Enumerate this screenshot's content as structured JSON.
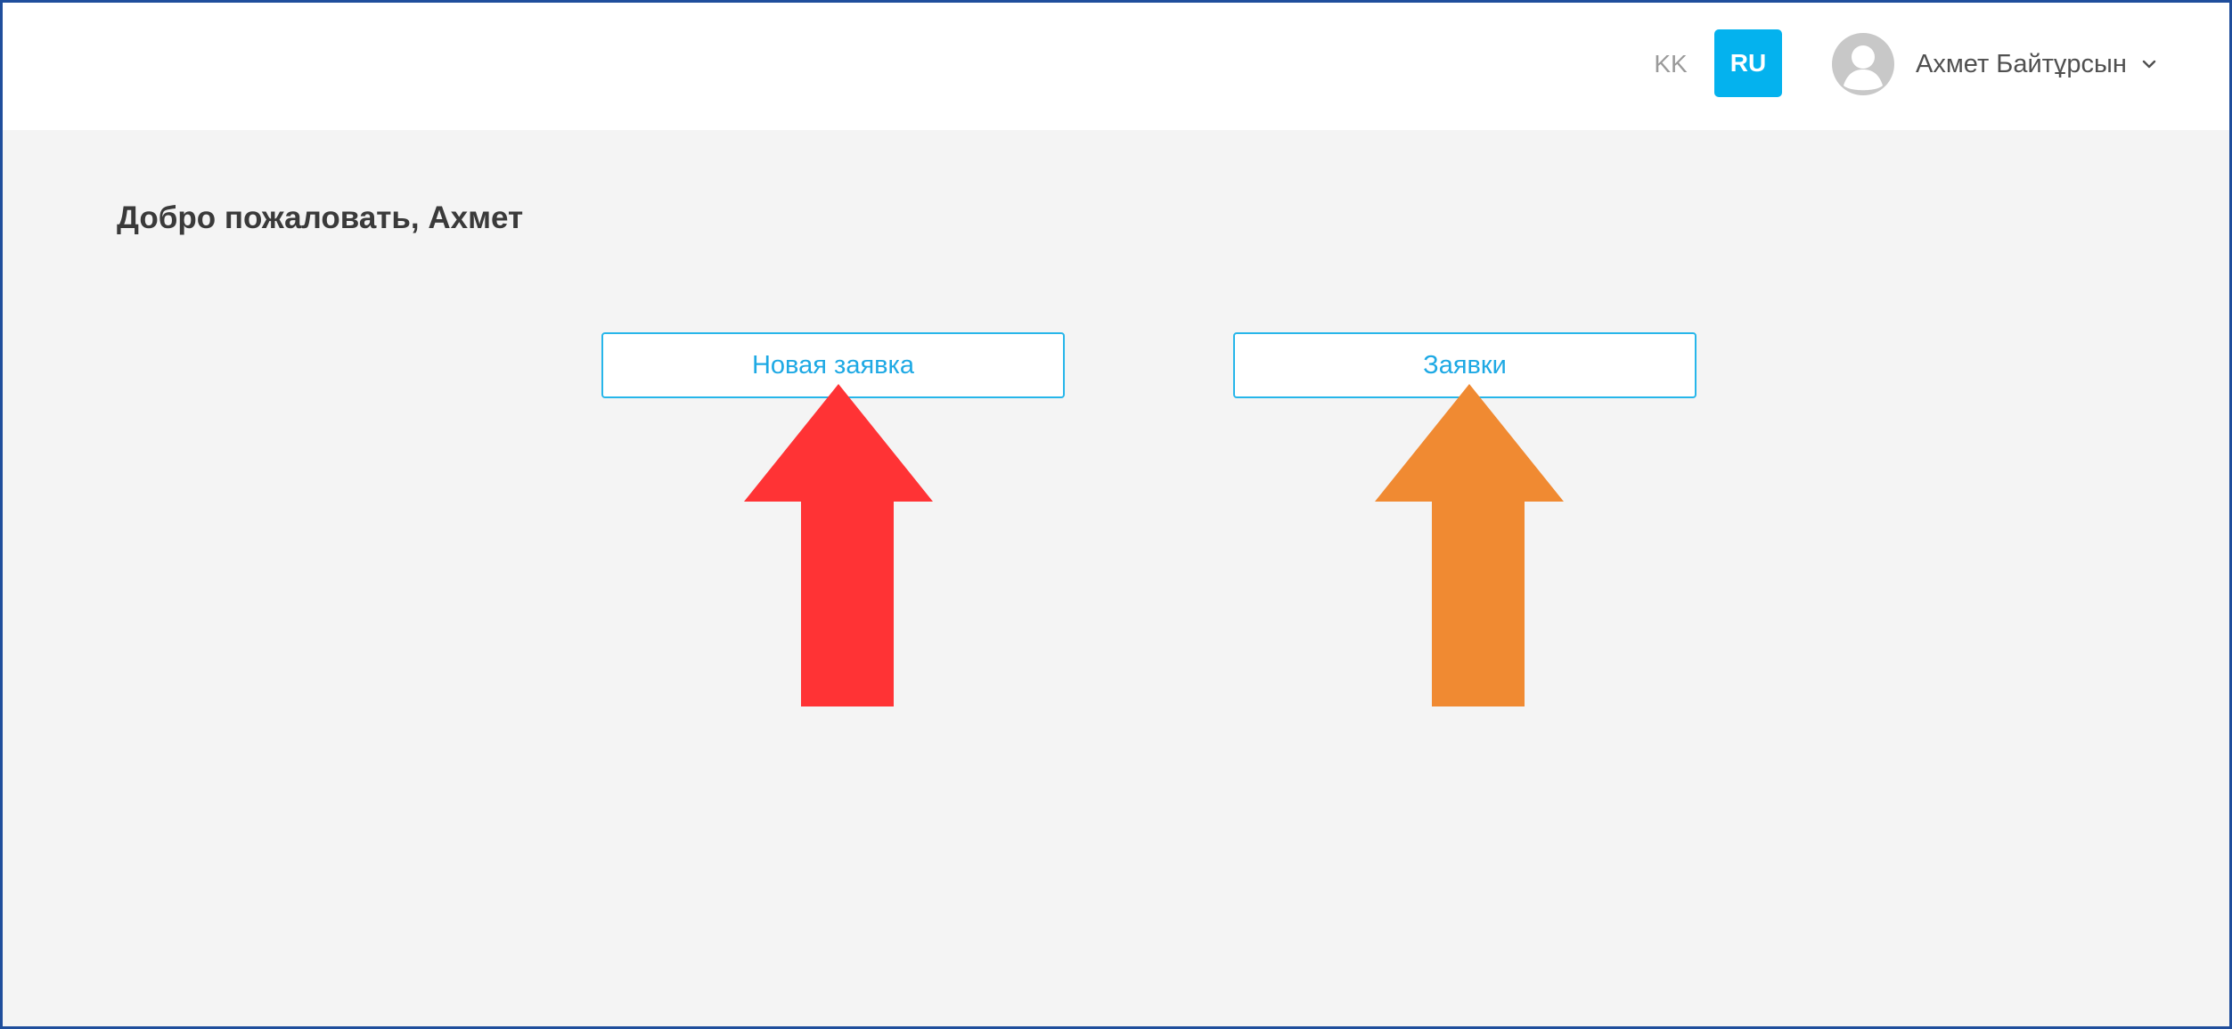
{
  "header": {
    "languages": {
      "kk_label": "KK",
      "ru_label": "RU",
      "active": "RU"
    },
    "user": {
      "name": "Ахмет Байтұрсын",
      "avatar_icon": "user-avatar-icon",
      "dropdown_icon": "chevron-down-icon"
    }
  },
  "main": {
    "welcome_text": "Добро пожаловать, Ахмет",
    "actions": {
      "new_request_label": "Новая заявка",
      "requests_label": "Заявки"
    }
  },
  "annotations": {
    "arrow_new_request_icon": "arrow-up-icon",
    "arrow_requests_icon": "arrow-up-icon"
  },
  "colors": {
    "accent": "#04b2ee",
    "button_text": "#1ea9e4",
    "button_border": "#27b6ea",
    "page_background": "#f4f4f4",
    "header_background": "#ffffff",
    "frame_border": "#1f4e9c",
    "arrow_red": "#ff3335",
    "arrow_orange": "#f08a32"
  }
}
